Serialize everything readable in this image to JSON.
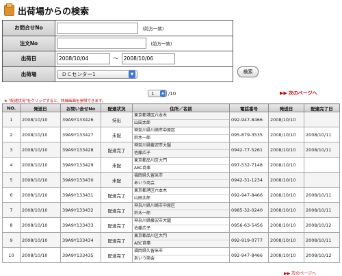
{
  "page": {
    "title": "出荷場からの検索"
  },
  "form": {
    "inquiry_no_label": "お問合せNo",
    "inquiry_no_value": "",
    "inquiry_no_note": "(前方一致)",
    "order_no_label": "注文No",
    "order_no_value": "",
    "order_no_note": "(前方一致)",
    "ship_date_label": "出荷日",
    "date_from": "2008/10/04",
    "date_separator": "～",
    "date_to": "2008/10/06",
    "warehouse_label": "出荷場",
    "warehouse_value": "ＤＣセンター1",
    "search_button": "検索"
  },
  "pager": {
    "current_page": "1",
    "total_pages": "/10",
    "next_link": "次のページへ",
    "hint": "\"配達状況\"をクリックすると、詳細画面を参照できます。"
  },
  "table": {
    "headers": [
      "NO.",
      "発送日",
      "お問い合せNo",
      "配達状況",
      "住所／名前",
      "電話番号",
      "発送日",
      "配達完了日"
    ],
    "rows": [
      {
        "no": "1",
        "ship_date": "2008/10/10",
        "inquiry": "39A9Y133426",
        "status": "持出",
        "addr": "東京都港区六本木",
        "name": "山田太郎",
        "phone": "092-947-8466",
        "ship_date2": "2008/10/10",
        "done_date": ""
      },
      {
        "no": "2",
        "ship_date": "2008/10/10",
        "inquiry": "39A9Y133427",
        "status": "未配",
        "addr": "神奈川県川崎市中原区",
        "name": "鈴木一郎",
        "phone": "095-879-3535",
        "ship_date2": "2008/10/10",
        "done_date": "2008/10/11"
      },
      {
        "no": "3",
        "ship_date": "2008/10/10",
        "inquiry": "39A9Y133428",
        "status": "配達完了",
        "addr": "神奈川県藤沢市大鋸",
        "name": "佐藤広子",
        "phone": "0942-77-5261",
        "ship_date2": "2008/10/10",
        "done_date": "2008/10/11"
      },
      {
        "no": "4",
        "ship_date": "2008/10/10",
        "inquiry": "39A9Y133429",
        "status": "未配",
        "addr": "東京都品川区大門",
        "name": "ABC商事",
        "phone": "097-532-7148",
        "ship_date2": "2008/10/10",
        "done_date": ""
      },
      {
        "no": "5",
        "ship_date": "2008/10/10",
        "inquiry": "39A9Y133430",
        "status": "未配",
        "addr": "福岡県久留米市",
        "name": "あいう商会",
        "phone": "0942-31-1234",
        "ship_date2": "2008/10/10",
        "done_date": ""
      },
      {
        "no": "6",
        "ship_date": "2008/10/10",
        "inquiry": "39A9Y133431",
        "status": "配達完了",
        "addr": "東京都港区六本木",
        "name": "山田太郎",
        "phone": "092-947-8466",
        "ship_date2": "2008/10/10",
        "done_date": "2008/10/11"
      },
      {
        "no": "7",
        "ship_date": "2008/10/10",
        "inquiry": "39A9Y133432",
        "status": "配達完了",
        "addr": "神奈川県川崎市中原区",
        "name": "鈴木一郎",
        "phone": "0985-32-0240",
        "ship_date2": "2008/10/10",
        "done_date": "2008/10/11"
      },
      {
        "no": "8",
        "ship_date": "2008/10/10",
        "inquiry": "39A9Y133433",
        "status": "配達完了",
        "addr": "神奈川県藤沢市大鋸",
        "name": "佐藤広子",
        "phone": "0956-63-5456",
        "ship_date2": "2008/10/10",
        "done_date": "2008/10/12"
      },
      {
        "no": "9",
        "ship_date": "2008/10/10",
        "inquiry": "39A9Y133434",
        "status": "配達完了",
        "addr": "東京都品川区大門",
        "name": "ABC商事",
        "phone": "092-919-0777",
        "ship_date2": "2008/10/10",
        "done_date": "2008/10/11"
      },
      {
        "no": "10",
        "ship_date": "2008/10/10",
        "inquiry": "39A9Y133435",
        "status": "配達完了",
        "addr": "福岡県久留米市",
        "name": "あいう商会",
        "phone": "092-947-8466",
        "ship_date2": "2008/10/10",
        "done_date": "2008/10/12"
      }
    ]
  },
  "colors": {
    "accent_red": "#cc0000",
    "status_blue": "#1e52c8",
    "header_gray": "#d9d9d9"
  },
  "icons": {
    "title_icon": "box-icon",
    "dropdown_icon": "dropdown-arrow-icon",
    "next_icon": "double-triangle-right-icon"
  }
}
